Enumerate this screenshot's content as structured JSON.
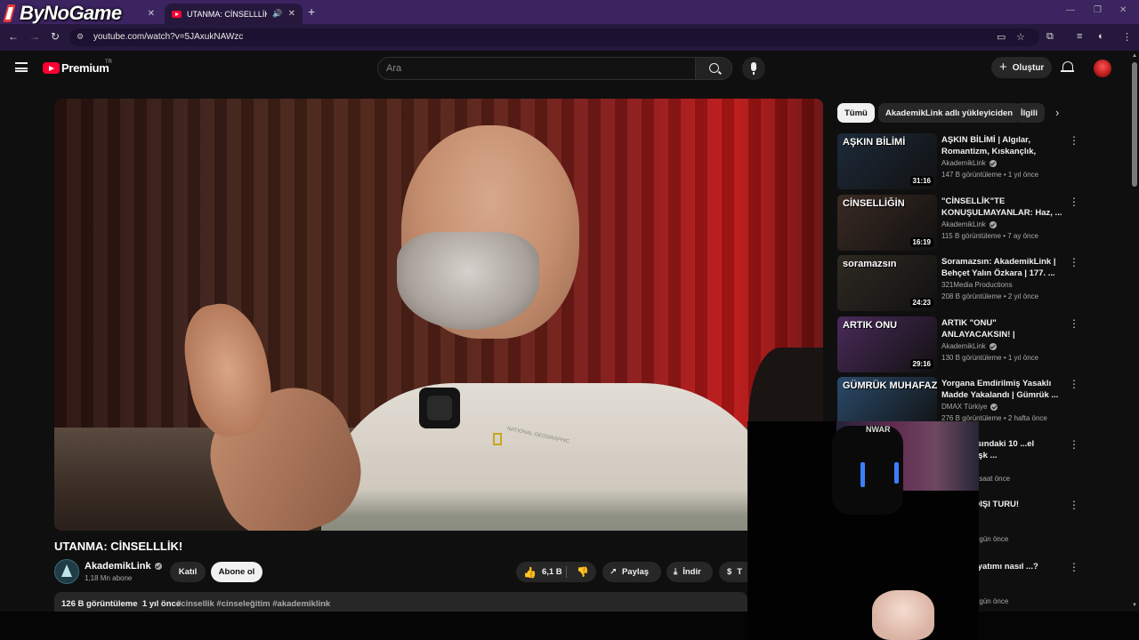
{
  "browser": {
    "watermark": "ByNoGame",
    "tabs": [
      {
        "label": "",
        "active": false
      },
      {
        "label": "UTANMA: CİNSELLLİK! - You",
        "active": true
      }
    ],
    "url": "youtube.com/watch?v=5JAxukNAWzc"
  },
  "header": {
    "brand": "Premium",
    "country": "TR",
    "search_placeholder": "Ara",
    "create_label": "Oluştur"
  },
  "video": {
    "title": "UTANMA: CİNSELLLİK!",
    "channel": "AkademikLink",
    "subscribers": "1,18 Mn abone",
    "join_label": "Katıl",
    "subscribe_label": "Abone ol",
    "likes": "6,1 B",
    "share_label": "Paylaş",
    "download_label": "İndir",
    "thanks_label": "T",
    "views": "126 B görüntüleme",
    "age": "1 yıl önce",
    "tags": "#cinsellik #cinseleğitim #akademiklink",
    "overlay_logo_text": "NATIONAL GEOGRAPHIC"
  },
  "chips": [
    "Tümü",
    "AkademikLink adlı yükleyiciden",
    "İlgili"
  ],
  "recommendations": [
    {
      "title": "AŞKIN BİLİMİ | Algılar, Romantizm, Kıskançlık, Dürtüler",
      "channel": "AkademikLink",
      "verified": true,
      "meta": "147 B görüntüleme • 1 yıl önce",
      "duration": "31:16",
      "thumb_text": "AŞKIN BİLİMİ",
      "thumb_color": "#1d2a3a"
    },
    {
      "title": "\"CİNSELLİK\"TE KONUŞULMAYANLAR: Haz, ...",
      "channel": "AkademikLink",
      "verified": true,
      "meta": "115 B görüntüleme • 7 ay önce",
      "duration": "16:19",
      "thumb_text": "CİNSELLİĞİN",
      "thumb_color": "#3a2a22"
    },
    {
      "title": "Soramazsın: AkademikLink | Behçet Yalın Özkara | 177. ...",
      "channel": "321Media Productions",
      "verified": false,
      "meta": "208 B görüntüleme • 2 yıl önce",
      "duration": "24:23",
      "thumb_text": "soramazsın",
      "thumb_color": "#2e2a22"
    },
    {
      "title": "ARTIK \"ONU\" ANLAYACAKSIN! | Cinsiyetlerin Bilimsel Gerçekleri",
      "channel": "AkademikLink",
      "verified": true,
      "meta": "130 B görüntüleme • 1 yıl önce",
      "duration": "29:16",
      "thumb_text": "ARTIK ONU",
      "thumb_color": "#4a2a5a"
    },
    {
      "title": "Yorgana Emdirilmiş Yasaklı Madde Yakalandı | Gümrük ...",
      "channel": "DMAX Türkiye",
      "verified": true,
      "meta": "276 B görüntüleme • 2 hafta önce",
      "duration": "",
      "thumb_text": "GÜMRÜK MUHAFAZA",
      "thumb_color": "#2a4a6a"
    },
    {
      "title": "...vet Arasındaki 10 ...el Arzuyu Aşk ...",
      "channel": "...ak",
      "verified": true,
      "meta": "...üleme • 9 saat önce",
      "duration": "",
      "thumb_text": "",
      "thumb_color": "#1a1a1a"
    },
    {
      "title": "...YURT DIŞI TURU!",
      "channel": "...ak",
      "verified": true,
      "meta": "...üleme • 2 gün önce",
      "duration": "",
      "thumb_text": "",
      "thumb_color": "#1a1a1a"
    },
    {
      "title": "...mak hayatımı nasıl ...?",
      "channel": "",
      "verified": false,
      "meta": "...üleme • 9 gün önce",
      "duration": "",
      "thumb_text": "",
      "thumb_color": "#1a1a1a"
    }
  ],
  "webcam": {
    "logo": "NWAR"
  }
}
